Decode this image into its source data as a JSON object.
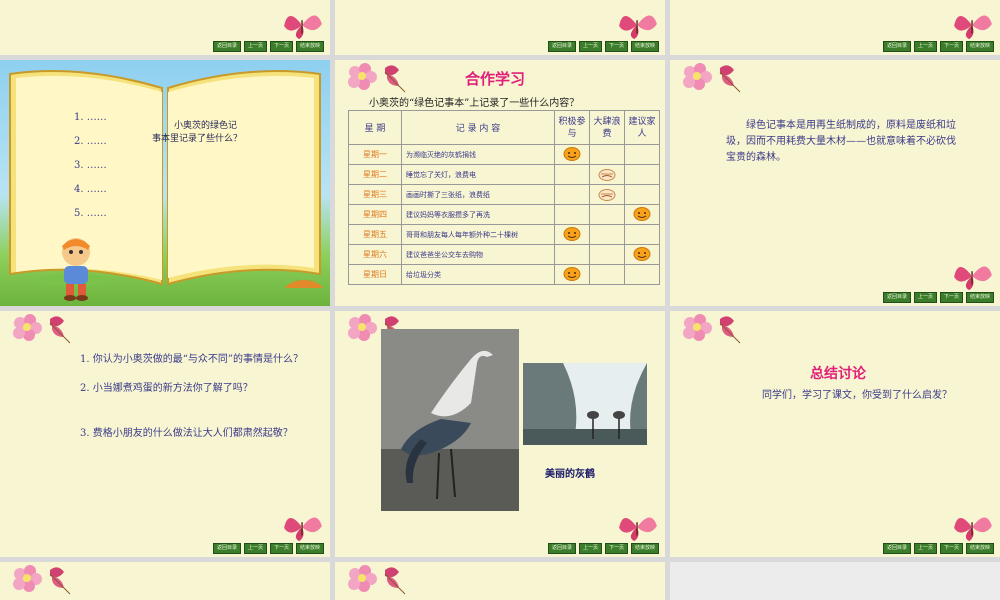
{
  "nav_buttons": [
    "返回目录",
    "上一页",
    "下一页",
    "结束放映"
  ],
  "slide_book": {
    "items": [
      "1. ……",
      "2. ……",
      "3. ……",
      "4. ……",
      "5. ……"
    ],
    "question_line1": "小奥茨的绿色记",
    "question_line2": "事本里记录了些什么？"
  },
  "slide_table": {
    "title": "合作学习",
    "question": "小奥茨的“绿色记事本”上记录了一些什么内容？",
    "headers": [
      "星  期",
      "记    录    内    容",
      "积极参与",
      "大肆浪费",
      "建议家人"
    ],
    "rows": [
      {
        "day": "星期一",
        "content": "为濒临灭绝的灰鹤捐钱",
        "mark": 0
      },
      {
        "day": "星期二",
        "content": "睡觉忘了关灯，浪费电",
        "mark": 1
      },
      {
        "day": "星期三",
        "content": "画画时撕了三张纸，浪费纸",
        "mark": 1
      },
      {
        "day": "星期四",
        "content": "建议妈妈等衣服攒多了再洗",
        "mark": 2
      },
      {
        "day": "星期五",
        "content": "哥哥和朋友每人每年额外种二十棵树",
        "mark": 0
      },
      {
        "day": "星期六",
        "content": "建议爸爸坐公交车去购物",
        "mark": 2
      },
      {
        "day": "星期日",
        "content": "给垃圾分类",
        "mark": 0
      }
    ]
  },
  "slide_note": {
    "text": "绿色记事本是用再生纸制成的，原料是废纸和垃圾，因而不用耗费大量木材——也就意味着不必砍伐宝贵的森林。"
  },
  "slide_questions": {
    "q1": "1. 你认为小奥茨做的最“与众不同”的事情是什么？",
    "q2": "2. 小当娜煮鸡蛋的新方法你了解了吗？",
    "q3": "3. 费格小朋友的什么做法让大人们都肃然起敬？"
  },
  "slide_crane": {
    "caption": "美丽的灰鹤"
  },
  "slide_summary": {
    "title": "总结讨论",
    "text": "同学们，学习了课文，你受到了什么启发？"
  },
  "colors": {
    "slide_bg": "#f8f5d2",
    "text_blue": "#3a3a8a",
    "title_pink": "#e0207a",
    "day_orange": "#e07a20",
    "nav_green": "#3c7d2b"
  }
}
